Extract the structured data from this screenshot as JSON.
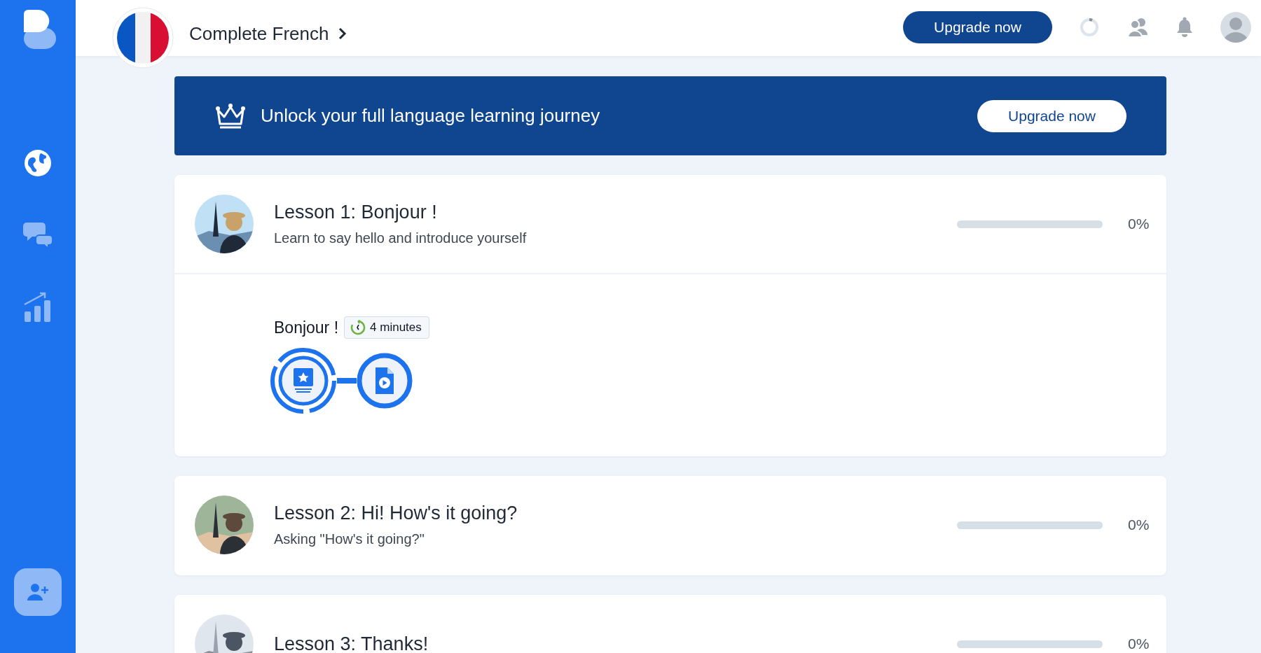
{
  "sidebar": {
    "items": [
      {
        "kind": "globe",
        "selected": true
      },
      {
        "kind": "chat",
        "selected": false
      },
      {
        "kind": "stats",
        "selected": false
      }
    ]
  },
  "header": {
    "course_title": "Complete French",
    "upgrade_button": "Upgrade now"
  },
  "banner": {
    "text": "Unlock your full language learning journey",
    "button": "Upgrade now"
  },
  "lessons": [
    {
      "title": "Lesson 1: Bonjour !",
      "subtitle": "Learn to say hello and introduce yourself",
      "level": 0,
      "percent": "0%",
      "expanded": true,
      "activity": {
        "title": "Bonjour !",
        "duration": "4 minutes",
        "nodes": [
          {
            "kind": "flashcards",
            "current": true
          },
          {
            "kind": "video",
            "current": false
          }
        ]
      }
    },
    {
      "title": "Lesson 2: Hi! How's it going?",
      "subtitle": "Asking \"How's it going?\"",
      "level": 0,
      "percent": "0%",
      "expanded": false
    },
    {
      "title": "Lesson 3: Thanks!",
      "level": 0,
      "percent": "0%",
      "expanded": false
    }
  ]
}
